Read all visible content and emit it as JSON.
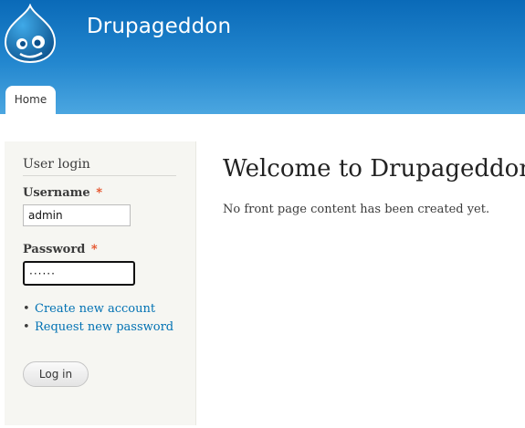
{
  "site": {
    "name": "Drupageddon"
  },
  "nav": {
    "tabs": [
      {
        "label": "Home"
      }
    ]
  },
  "sidebar": {
    "block_title": "User login",
    "username": {
      "label": "Username",
      "required_mark": "*",
      "value": "admin"
    },
    "password": {
      "label": "Password",
      "required_mark": "*",
      "value": "······"
    },
    "links": [
      {
        "label": "Create new account"
      },
      {
        "label": "Request new password"
      }
    ],
    "login_button": "Log in"
  },
  "main": {
    "title": "Welcome to Drupageddon",
    "message": "No front page content has been created yet."
  },
  "colors": {
    "header_top": "#0a6ab8",
    "header_bottom": "#4ba6e0",
    "link": "#0071b3",
    "required": "#e4491f",
    "sidebar_bg": "#f6f6f2"
  },
  "icons": {
    "logo": "drupal-drop-logo-icon"
  }
}
